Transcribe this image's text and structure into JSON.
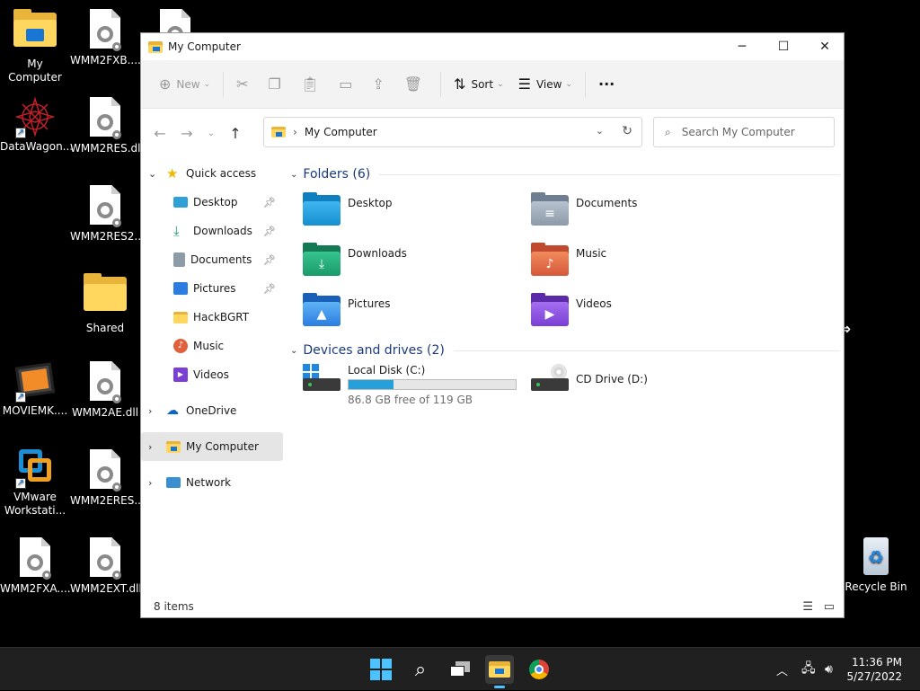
{
  "desktop": {
    "icons": [
      {
        "label": "My Computer"
      },
      {
        "label": "WMM2FXB...."
      },
      {
        "label": ""
      },
      {
        "label": "DataWagon..."
      },
      {
        "label": "WMM2RES.dll"
      },
      {
        "label": "WMM2RES2...."
      },
      {
        "label": "Shared"
      },
      {
        "label": "MOVIEMK...."
      },
      {
        "label": "WMM2AE.dll"
      },
      {
        "label": "VMware Workstati..."
      },
      {
        "label": "WMM2ERES...."
      },
      {
        "label": "WMM2FXA...."
      },
      {
        "label": "WMM2EXT.dll"
      },
      {
        "label": "Recycle Bin"
      }
    ]
  },
  "window": {
    "title": "My Computer",
    "toolbar": {
      "new_label": "New",
      "sort_label": "Sort",
      "view_label": "View",
      "more_label": "···"
    },
    "address": {
      "path": "My Computer"
    },
    "search": {
      "placeholder": "Search My Computer"
    },
    "sidebar": {
      "quick_access": "Quick access",
      "items": [
        {
          "label": "Desktop"
        },
        {
          "label": "Downloads"
        },
        {
          "label": "Documents"
        },
        {
          "label": "Pictures"
        },
        {
          "label": "HackBGRT"
        },
        {
          "label": "Music"
        },
        {
          "label": "Videos"
        }
      ],
      "onedrive": "OneDrive",
      "my_computer": "My Computer",
      "network": "Network"
    },
    "folders_header": "Folders (6)",
    "folders": [
      {
        "label": "Desktop"
      },
      {
        "label": "Documents"
      },
      {
        "label": "Downloads"
      },
      {
        "label": "Music"
      },
      {
        "label": "Pictures"
      },
      {
        "label": "Videos"
      }
    ],
    "drives_header": "Devices and drives (2)",
    "drives": [
      {
        "label": "Local Disk (C:)",
        "free": "86.8 GB free of 119 GB",
        "used_fraction": 0.27
      },
      {
        "label": "CD Drive (D:)"
      }
    ],
    "status": {
      "items": "8 items"
    }
  },
  "taskbar": {
    "time": "11:36 PM",
    "date": "5/27/2022"
  },
  "colors": {
    "accent": "#26a0da",
    "folder_yellow": "#ffd65e",
    "taskbar_bg": "#202020"
  }
}
